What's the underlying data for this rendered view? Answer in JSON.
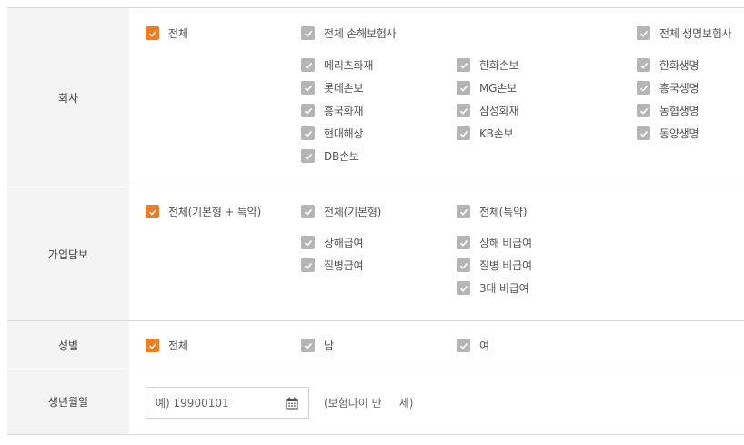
{
  "colors": {
    "checked": "#f07c22",
    "unchecked": "#b5b5b5",
    "label_bg": "#f4f4f4",
    "border": "#d9d9d9"
  },
  "company": {
    "label": "회사",
    "all": {
      "label": "전체",
      "checked": true
    },
    "nonlife_all": {
      "label": "전체 손해보험사",
      "checked": true
    },
    "life_all": {
      "label": "전체 생명보험사",
      "checked": true
    },
    "nonlife_col1": [
      "메리츠화재",
      "롯데손보",
      "흥국화재",
      "현대해상",
      "DB손보"
    ],
    "nonlife_col2": [
      "한화손보",
      "MG손보",
      "삼성화재",
      "KB손보"
    ],
    "life_col": [
      "한화생명",
      "흥국생명",
      "농협생명",
      "동양생명"
    ]
  },
  "coverage": {
    "label": "가입담보",
    "all": {
      "label": "전체(기본형 + 특약)",
      "checked": true
    },
    "basic_all": {
      "label": "전체(기본형)",
      "checked": true
    },
    "rider_all": {
      "label": "전체(특약)",
      "checked": true
    },
    "basic_items": [
      "상해급여",
      "질병급여"
    ],
    "rider_items": [
      "상해 비급여",
      "질병 비급여",
      "3대 비급여"
    ]
  },
  "gender": {
    "label": "성별",
    "all": {
      "label": "전체",
      "checked": true
    },
    "male": {
      "label": "남",
      "checked": true
    },
    "female": {
      "label": "여",
      "checked": true
    }
  },
  "birth": {
    "label": "생년월일",
    "placeholder": "예) 19900101",
    "value": "",
    "calendar_icon": "calendar-icon",
    "age_note": "(보험나이 만     세)"
  }
}
